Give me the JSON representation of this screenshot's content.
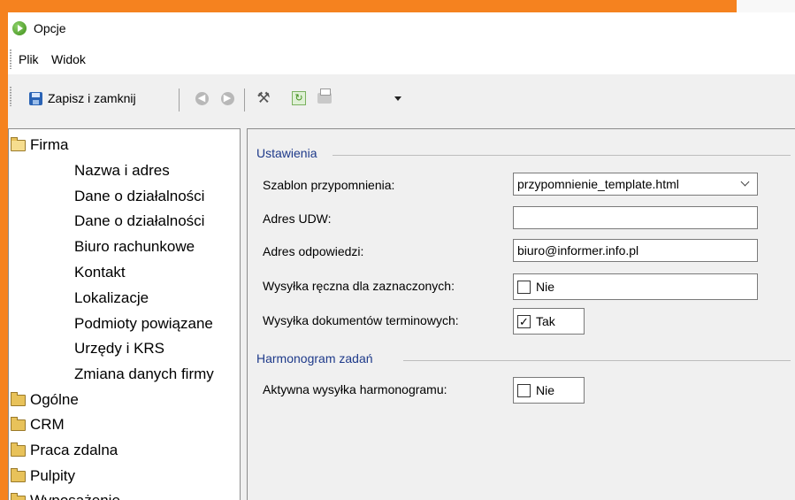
{
  "window": {
    "title": "Opcje",
    "icon": "play-circle-icon"
  },
  "menu": {
    "items": [
      "Plik",
      "Widok"
    ]
  },
  "toolbar": {
    "save_label": "Zapisz i zamknij",
    "icons": [
      "floppy-icon",
      "back-icon",
      "forward-icon",
      "tools-icon",
      "refresh-icon",
      "printer-icon",
      "dropdown-arrow-icon"
    ]
  },
  "tree": {
    "root": "Firma",
    "children": [
      "Nazwa i adres",
      "Dane o działalności",
      "Dane o działalności",
      "Biuro rachunkowe",
      "Kontakt",
      "Lokalizacje",
      "Podmioty powiązane",
      "Urzędy i KRS",
      "Zmiana danych firmy"
    ],
    "folders": [
      "Ogólne",
      "CRM",
      "Praca zdalna",
      "Pulpity",
      "Wyposażenie"
    ]
  },
  "settings": {
    "group1_title": "Ustawienia",
    "template_label": "Szablon przypomnienia:",
    "template_value": "przypomnienie_template.html",
    "udw_label": "Adres UDW:",
    "udw_value": "",
    "reply_label": "Adres odpowiedzi:",
    "reply_value": "biuro@informer.info.pl",
    "manual_label": "Wysyłka ręczna dla zaznaczonych:",
    "manual_value": "Nie",
    "manual_checked": false,
    "docs_label": "Wysyłka dokumentów terminowych:",
    "docs_value": "Tak",
    "docs_checked": true,
    "group2_title": "Harmonogram zadań",
    "schedule_label": "Aktywna wysyłka harmonogramu:",
    "schedule_value": "Nie",
    "schedule_checked": false
  },
  "colors": {
    "frame": "#f5821f",
    "group_title": "#1e3a8a"
  }
}
